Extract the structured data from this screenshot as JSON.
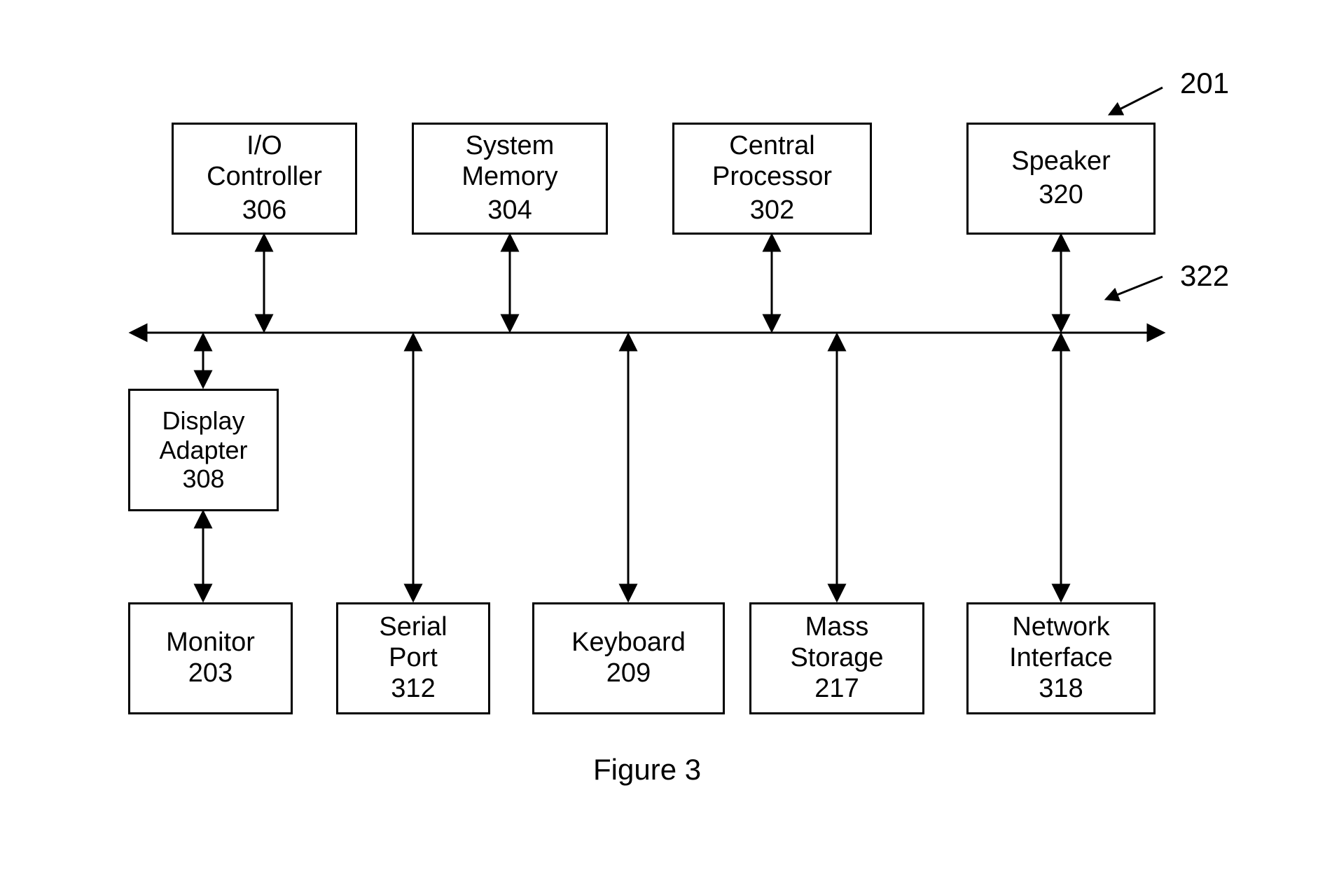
{
  "figure_caption": "Figure 3",
  "callouts": {
    "ref_201": "201",
    "ref_322": "322"
  },
  "top_row": {
    "io_controller": {
      "line1": "I/O",
      "line2": "Controller",
      "num": "306"
    },
    "system_memory": {
      "line1": "System",
      "line2": "Memory",
      "num": "304"
    },
    "central_processor": {
      "line1": "Central",
      "line2": "Processor",
      "num": "302"
    },
    "speaker": {
      "line1": "Speaker",
      "num": "320"
    }
  },
  "mid": {
    "display_adapter": {
      "line1": "Display",
      "line2": "Adapter",
      "num": "308"
    }
  },
  "bottom_row": {
    "monitor": {
      "line1": "Monitor",
      "num": "203"
    },
    "serial_port": {
      "line1": "Serial",
      "line2": "Port",
      "num": "312"
    },
    "keyboard": {
      "line1": "Keyboard",
      "num": "209"
    },
    "mass_storage": {
      "line1": "Mass",
      "line2": "Storage",
      "num": "217"
    },
    "network_interface": {
      "line1": "Network",
      "line2": "Interface",
      "num": "318"
    }
  },
  "bus_ref": "322",
  "system_ref": "201"
}
